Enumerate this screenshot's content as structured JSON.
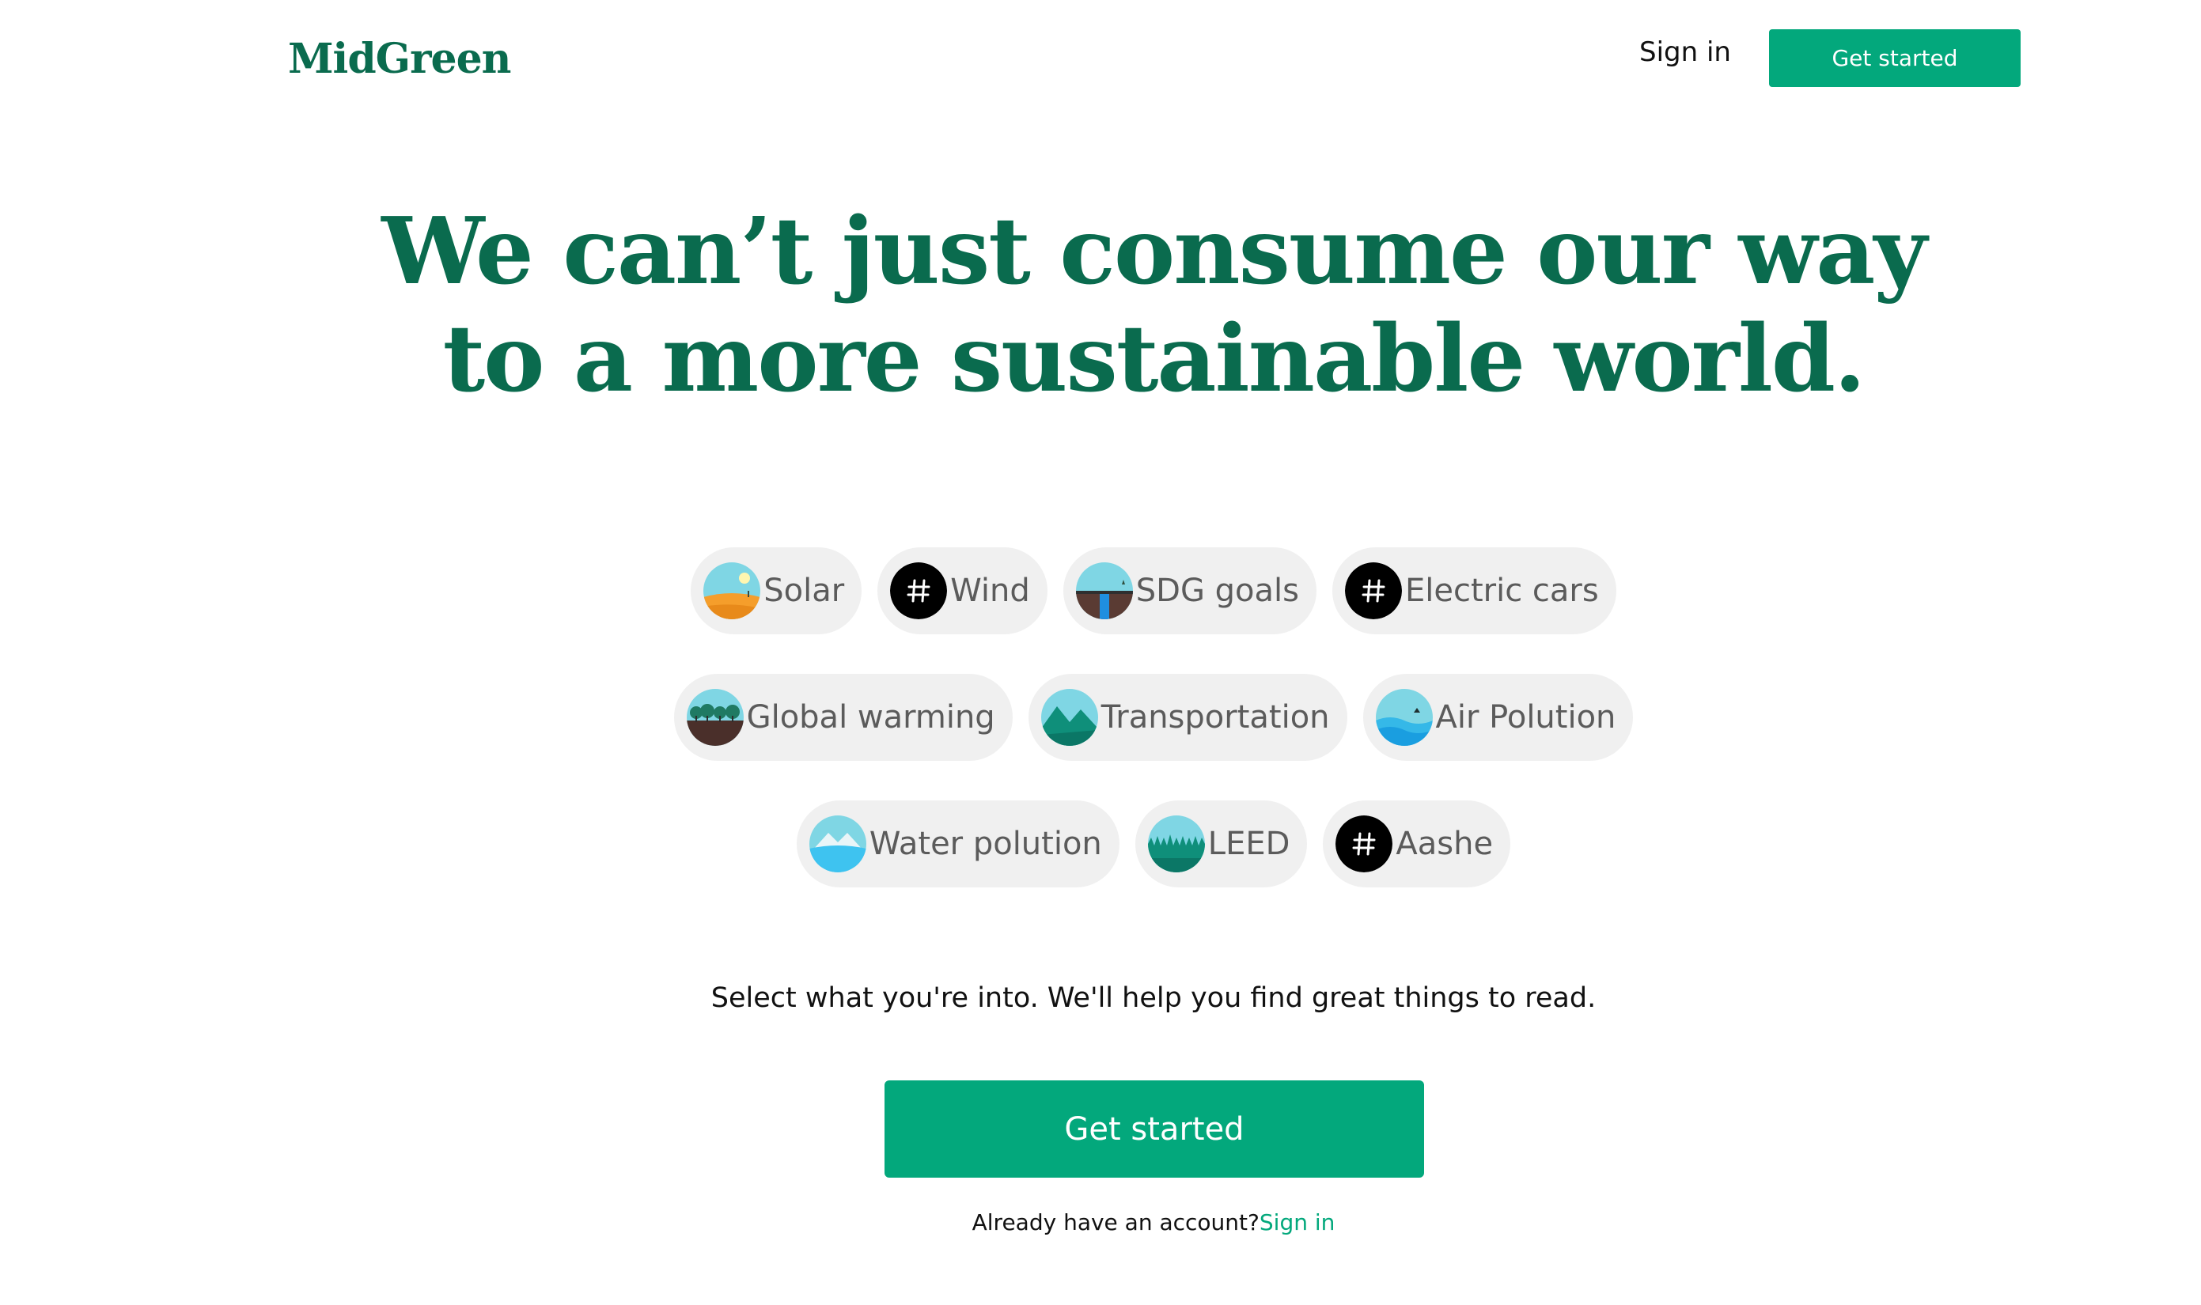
{
  "header": {
    "logo": "MidGreen",
    "signin_label": "Sign in",
    "cta_label": "Get started"
  },
  "hero": {
    "line1": "We can’t just consume our way",
    "line2": "to a more sustainable world."
  },
  "topics": [
    {
      "label": "Solar",
      "icon": "solar-landscape-icon"
    },
    {
      "label": "Wind",
      "icon": "hashtag-icon"
    },
    {
      "label": "SDG goals",
      "icon": "waterfall-landscape-icon"
    },
    {
      "label": "Electric cars",
      "icon": "hashtag-icon"
    },
    {
      "label": "Global warming",
      "icon": "forest-landscape-icon"
    },
    {
      "label": "Transportation",
      "icon": "mountain-landscape-icon"
    },
    {
      "label": "Air Polution",
      "icon": "sea-landscape-icon"
    },
    {
      "label": "Water polution",
      "icon": "snow-mountain-landscape-icon"
    },
    {
      "label": "LEED",
      "icon": "grass-landscape-icon"
    },
    {
      "label": "Aashe",
      "icon": "hashtag-icon"
    }
  ],
  "tagline": "Select what you're into. We'll help you find great things to read.",
  "main_cta_label": "Get started",
  "account": {
    "prompt": "Already have an account?",
    "link": "Sign in"
  },
  "colors": {
    "brand_green": "#0a6b4e",
    "button_green": "#03a87c",
    "chip_background": "#f0f0f0"
  }
}
